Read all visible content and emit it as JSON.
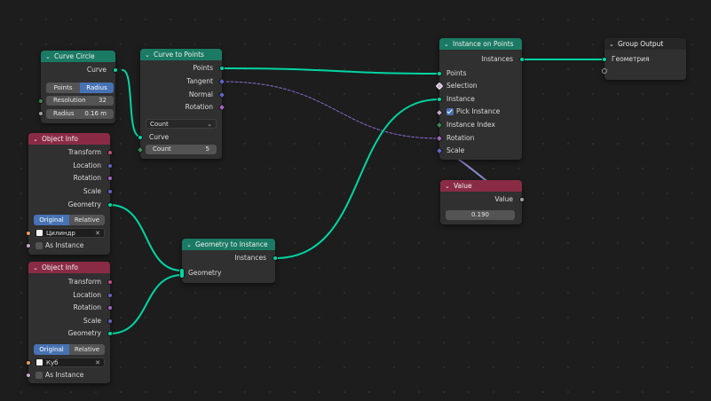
{
  "colors": {
    "geometry_socket": "#00d6a3",
    "vector_socket": "#6363c7",
    "rotation_socket": "#a763c7",
    "boolean_socket": "#cca6d6",
    "object_socket": "#ed9e5c",
    "float_socket": "#a1a1a1",
    "geometry_header": "#1a7a63",
    "input_header": "#8a2b45",
    "output_header": "#262626",
    "selected_button": "#4772b3"
  },
  "curve_circle": {
    "title": "Curve Circle",
    "output_curve": "Curve",
    "mode_points": "Points",
    "mode_radius": "Radius",
    "resolution_label": "Resolution",
    "resolution_value": "32",
    "radius_label": "Radius",
    "radius_value": "0.16 m"
  },
  "curve_to_points": {
    "title": "Curve to Points",
    "out_points": "Points",
    "out_tangent": "Tangent",
    "out_normal": "Normal",
    "out_rotation": "Rotation",
    "mode_value": "Count",
    "in_curve": "Curve",
    "count_label": "Count",
    "count_value": "5"
  },
  "object_info_1": {
    "title": "Object Info",
    "out_transform": "Transform",
    "out_location": "Location",
    "out_rotation": "Rotation",
    "out_scale": "Scale",
    "out_geometry": "Geometry",
    "mode_original": "Original",
    "mode_relative": "Relative",
    "object_name": "Цилиндр",
    "as_instance": "As Instance"
  },
  "object_info_2": {
    "title": "Object Info",
    "out_transform": "Transform",
    "out_location": "Location",
    "out_rotation": "Rotation",
    "out_scale": "Scale",
    "out_geometry": "Geometry",
    "mode_original": "Original",
    "mode_relative": "Relative",
    "object_name": "Куб",
    "as_instance": "As Instance"
  },
  "geometry_to_instance": {
    "title": "Geometry to Instance",
    "out_instances": "Instances",
    "in_geometry": "Geometry"
  },
  "instance_on_points": {
    "title": "Instance on Points",
    "out_instances": "Instances",
    "in_points": "Points",
    "in_selection": "Selection",
    "in_instance": "Instance",
    "pick_instance": "Pick Instance",
    "in_instance_index": "Instance Index",
    "in_rotation": "Rotation",
    "in_scale": "Scale"
  },
  "value_node": {
    "title": "Value",
    "out_value": "Value",
    "value": "0.190"
  },
  "group_output": {
    "title": "Group Output",
    "in_geometry": "Геометрия"
  }
}
